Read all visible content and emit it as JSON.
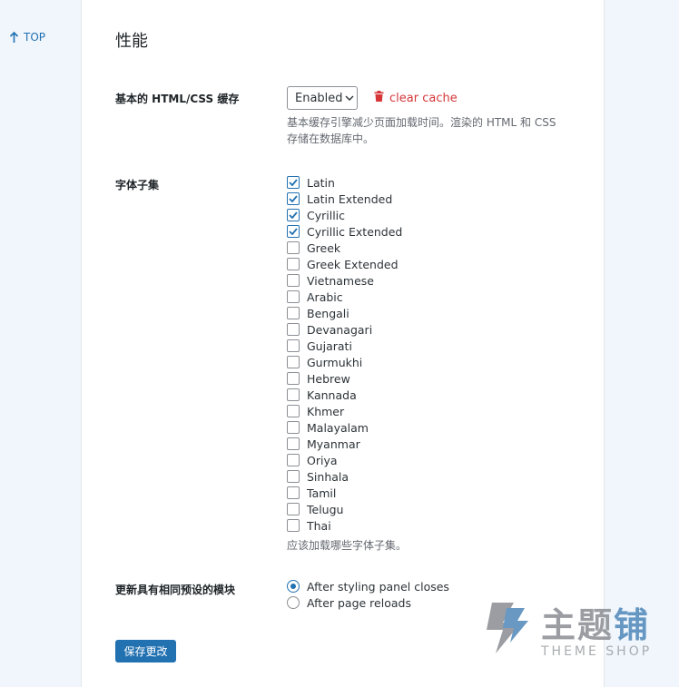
{
  "nav": {
    "top_label": "TOP"
  },
  "page": {
    "title": "性能"
  },
  "cache": {
    "label": "基本的 HTML/CSS 缓存",
    "select_value": "Enabled",
    "clear_label": "clear cache",
    "desc_line1": "基本缓存引擎减少页面加载时间。渲染的 HTML 和 CSS",
    "desc_line2": "存储在数据库中。"
  },
  "fonts": {
    "label": "字体子集",
    "desc": "应该加载哪些字体子集。",
    "subsets": [
      {
        "label": "Latin",
        "checked": true
      },
      {
        "label": "Latin Extended",
        "checked": true
      },
      {
        "label": "Cyrillic",
        "checked": true
      },
      {
        "label": "Cyrillic Extended",
        "checked": true
      },
      {
        "label": "Greek",
        "checked": false
      },
      {
        "label": "Greek Extended",
        "checked": false
      },
      {
        "label": "Vietnamese",
        "checked": false
      },
      {
        "label": "Arabic",
        "checked": false
      },
      {
        "label": "Bengali",
        "checked": false
      },
      {
        "label": "Devanagari",
        "checked": false
      },
      {
        "label": "Gujarati",
        "checked": false
      },
      {
        "label": "Gurmukhi",
        "checked": false
      },
      {
        "label": "Hebrew",
        "checked": false
      },
      {
        "label": "Kannada",
        "checked": false
      },
      {
        "label": "Khmer",
        "checked": false
      },
      {
        "label": "Malayalam",
        "checked": false
      },
      {
        "label": "Myanmar",
        "checked": false
      },
      {
        "label": "Oriya",
        "checked": false
      },
      {
        "label": "Sinhala",
        "checked": false
      },
      {
        "label": "Tamil",
        "checked": false
      },
      {
        "label": "Telugu",
        "checked": false
      },
      {
        "label": "Thai",
        "checked": false
      }
    ]
  },
  "modules": {
    "label": "更新具有相同预设的模块",
    "options": [
      {
        "label": "After styling panel closes",
        "selected": true
      },
      {
        "label": "After page reloads",
        "selected": false
      }
    ]
  },
  "actions": {
    "save_label": "保存更改"
  },
  "watermark": {
    "title_a": "主题",
    "title_b": "铺",
    "subtitle": "THEME SHOP"
  },
  "colors": {
    "accent": "#2271b1",
    "danger": "#d63638",
    "muted": "#646970"
  },
  "icons": {
    "top": "arrow-up-icon",
    "clear": "trash-icon",
    "select": "chevron-down-icon"
  }
}
